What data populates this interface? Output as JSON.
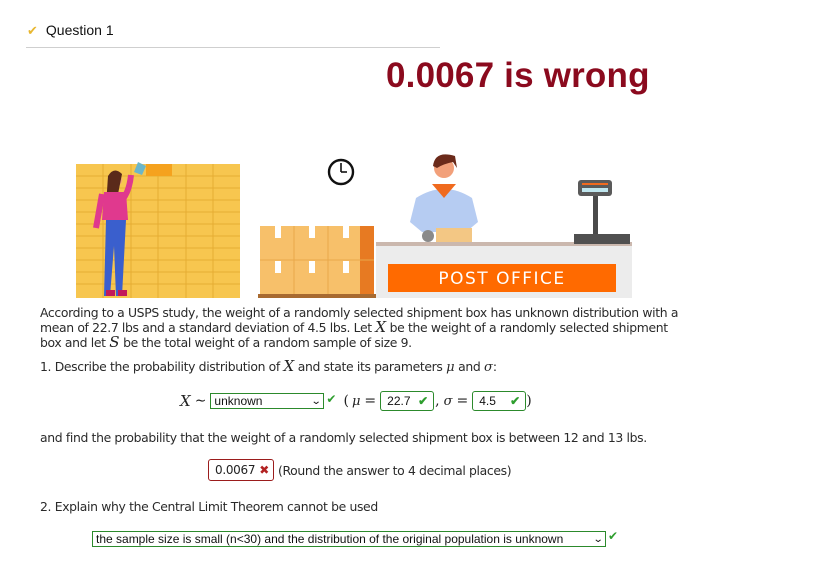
{
  "header": {
    "status_icon": "checkmark-icon",
    "title": "Question 1"
  },
  "verdict": {
    "text": "0.0067 is wrong",
    "color": "#8b0a1e"
  },
  "illustration": {
    "sign_text": "POST OFFICE",
    "icons": [
      "mailboxes-wall",
      "woman-figure",
      "wall-clock-icon",
      "cardboard-boxes",
      "postal-clerk",
      "counter",
      "scale-icon"
    ]
  },
  "problem": {
    "line1": "According to a USPS study, the weight of a randomly selected shipment box has unknown distribution with a",
    "line2a": "mean of 22.7 lbs and a standard deviation of 4.5 lbs. Let ",
    "var_x": "X",
    "line2b": " be the weight of a randomly selected shipment",
    "line3a": "box and let ",
    "var_s": "S",
    "line3b": "  be the total weight of a random sample of size 9."
  },
  "part1": {
    "prompt_a": "1. Describe the probability distribution of ",
    "var_x": "X",
    "prompt_b": " and state its parameters ",
    "mu": "μ",
    "and": " and ",
    "sigma": "σ",
    "colon": ":",
    "dist_label": "X",
    "tilde": "∼",
    "distribution_select": {
      "value": "unknown",
      "status": "correct"
    },
    "open_paren": "(",
    "mu_symbol": "μ",
    "equals": "=",
    "mu_input": {
      "value": "22.7",
      "status": "correct"
    },
    "comma": ",",
    "sigma_symbol": "σ",
    "sigma_input": {
      "value": "4.5",
      "status": "correct"
    },
    "close_paren": ")",
    "find_text": "and find the probability that the weight of a randomly selected shipment box is between 12 and 13 lbs.",
    "probability_input": {
      "value": "0.0067",
      "status": "incorrect"
    },
    "hint": "(Round the answer to 4 decimal places)"
  },
  "part2": {
    "prompt": "2. Explain why the Central Limit Theorem cannot be used",
    "reason_select": {
      "value": "the sample size is small (n<30) and the distribution of the original population is unknown",
      "status": "correct"
    }
  },
  "marks": {
    "correct": "✔",
    "incorrect": "✖",
    "chevron": "⌄"
  },
  "colors": {
    "correct": "#2e9e2e",
    "incorrect": "#b22222",
    "sign": "#ff6a00"
  }
}
